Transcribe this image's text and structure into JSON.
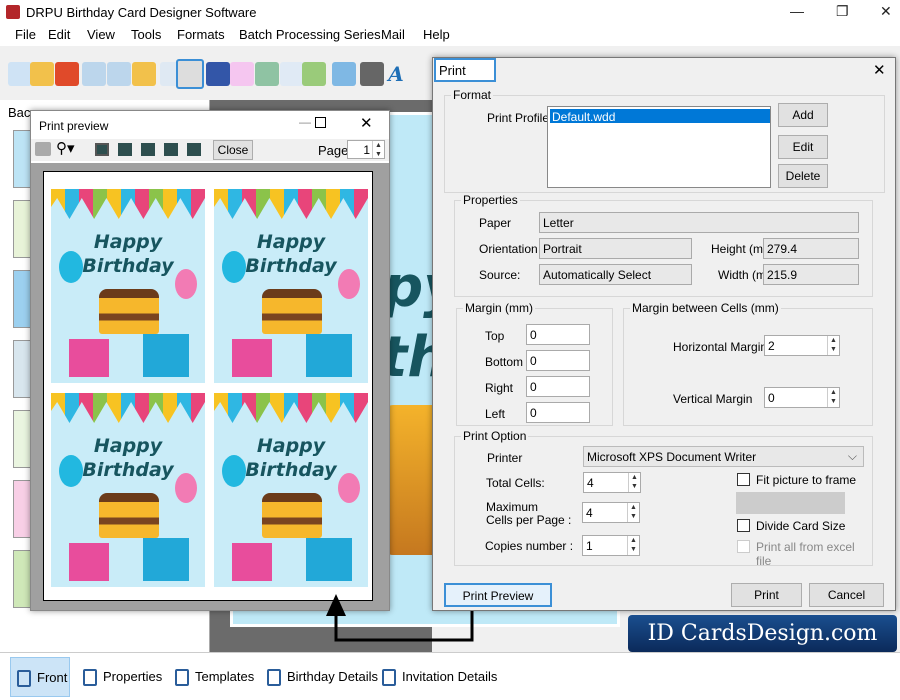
{
  "app": {
    "title": "DRPU Birthday Card Designer Software"
  },
  "menu": [
    "File",
    "Edit",
    "View",
    "Tools",
    "Formats",
    "Batch Processing Series",
    "Mail",
    "Help"
  ],
  "left_panel": {
    "label": "Bac"
  },
  "canvas": {
    "card_text_1": "ppy",
    "card_text_2": "rth"
  },
  "print_preview": {
    "title": "Print preview",
    "close_label": "Close",
    "page_label": "Page",
    "page_value": "1",
    "card_line1": "Happy",
    "card_line2": "Birthday"
  },
  "print_dialog": {
    "title": "Print",
    "format": {
      "legend": "Format",
      "profile_label": "Print Profile",
      "profile_selected": "Default.wdd",
      "add": "Add",
      "edit": "Edit",
      "delete": "Delete"
    },
    "properties": {
      "legend": "Properties",
      "paper_label": "Paper",
      "paper": "Letter",
      "orientation_label": "Orientation",
      "orientation": "Portrait",
      "height_label": "Height (mm)",
      "height": "279.4",
      "source_label": "Source:",
      "source": "Automatically Select",
      "width_label": "Width (mm)",
      "width": "215.9"
    },
    "margin": {
      "legend": "Margin (mm)",
      "top_label": "Top",
      "top": "0",
      "bottom_label": "Bottom",
      "bottom": "0",
      "right_label": "Right",
      "right": "0",
      "left_label": "Left",
      "left": "0"
    },
    "cell_margin": {
      "legend": "Margin between Cells (mm)",
      "h_label": "Horizontal Margin",
      "h": "2",
      "v_label": "Vertical Margin",
      "v": "0"
    },
    "print_option": {
      "legend": "Print Option",
      "printer_label": "Printer",
      "printer": "Microsoft XPS Document Writer",
      "total_label": "Total Cells:",
      "total": "4",
      "max_label_1": "Maximum",
      "max_label_2": "Cells per Page :",
      "max": "4",
      "copies_label": "Copies number :",
      "copies": "1",
      "fit_label": "Fit picture to frame",
      "divide_label": "Divide Card Size",
      "excel_label": "Print all from excel file"
    },
    "print_preview_btn": "Print Preview",
    "print_btn": "Print",
    "cancel_btn": "Cancel"
  },
  "bottom_tabs": [
    "Front",
    "Properties",
    "Templates",
    "Birthday Details",
    "Invitation Details"
  ],
  "watermark": "ID CardsDesign.com",
  "colors": {
    "highlight": "#3b8fd6",
    "accent": "#0078d7"
  }
}
